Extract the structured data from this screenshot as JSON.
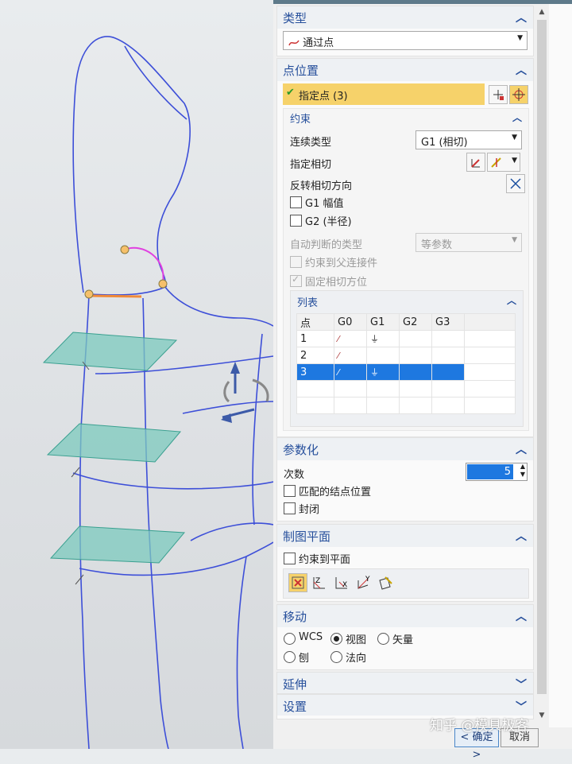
{
  "type_section": {
    "title": "类型",
    "value": "通过点"
  },
  "point_section": {
    "title": "点位置",
    "specify_point": "指定点 (3)"
  },
  "constraint": {
    "title": "约束",
    "continuity_label": "连续类型",
    "continuity_value": "G1 (相切)",
    "specify_tangent": "指定相切",
    "reverse_tangent": "反转相切方向",
    "g1_magnitude": "G1 幅值",
    "g2_radius": "G2 (半径)",
    "auto_type_label": "自动判断的类型",
    "auto_type_value": "等参数",
    "constrain_parent": "约束到父连接件",
    "fixed_tangent": "固定相切方位"
  },
  "list": {
    "title": "列表",
    "headers": [
      "点",
      "G0",
      "G1",
      "G2",
      "G3"
    ],
    "rows": [
      {
        "point": "1",
        "g0": true,
        "g1": true
      },
      {
        "point": "2",
        "g0": true,
        "g1": false
      },
      {
        "point": "3",
        "g0": true,
        "g1": true,
        "selected": true
      }
    ]
  },
  "parameterization": {
    "title": "参数化",
    "degree_label": "次数",
    "degree_value": "5",
    "match_knots": "匹配的结点位置",
    "closed": "封闭"
  },
  "drawing_plane": {
    "title": "制图平面",
    "constrain_to_plane": "约束到平面"
  },
  "move": {
    "title": "移动",
    "options": [
      "WCS",
      "视图",
      "矢量",
      "刨",
      "法向"
    ],
    "selected": "视图"
  },
  "extension": {
    "title": "延伸"
  },
  "settings": {
    "title": "设置"
  },
  "buttons": {
    "ok": "< 确定 >",
    "cancel": "取消"
  },
  "watermark": "知乎 @模具极客",
  "colors": {
    "accent": "#27509c",
    "highlight": "#f6d26a",
    "selection": "#1e78e0",
    "curve": "#3d4fd8",
    "plane": "#7cc9bd"
  }
}
